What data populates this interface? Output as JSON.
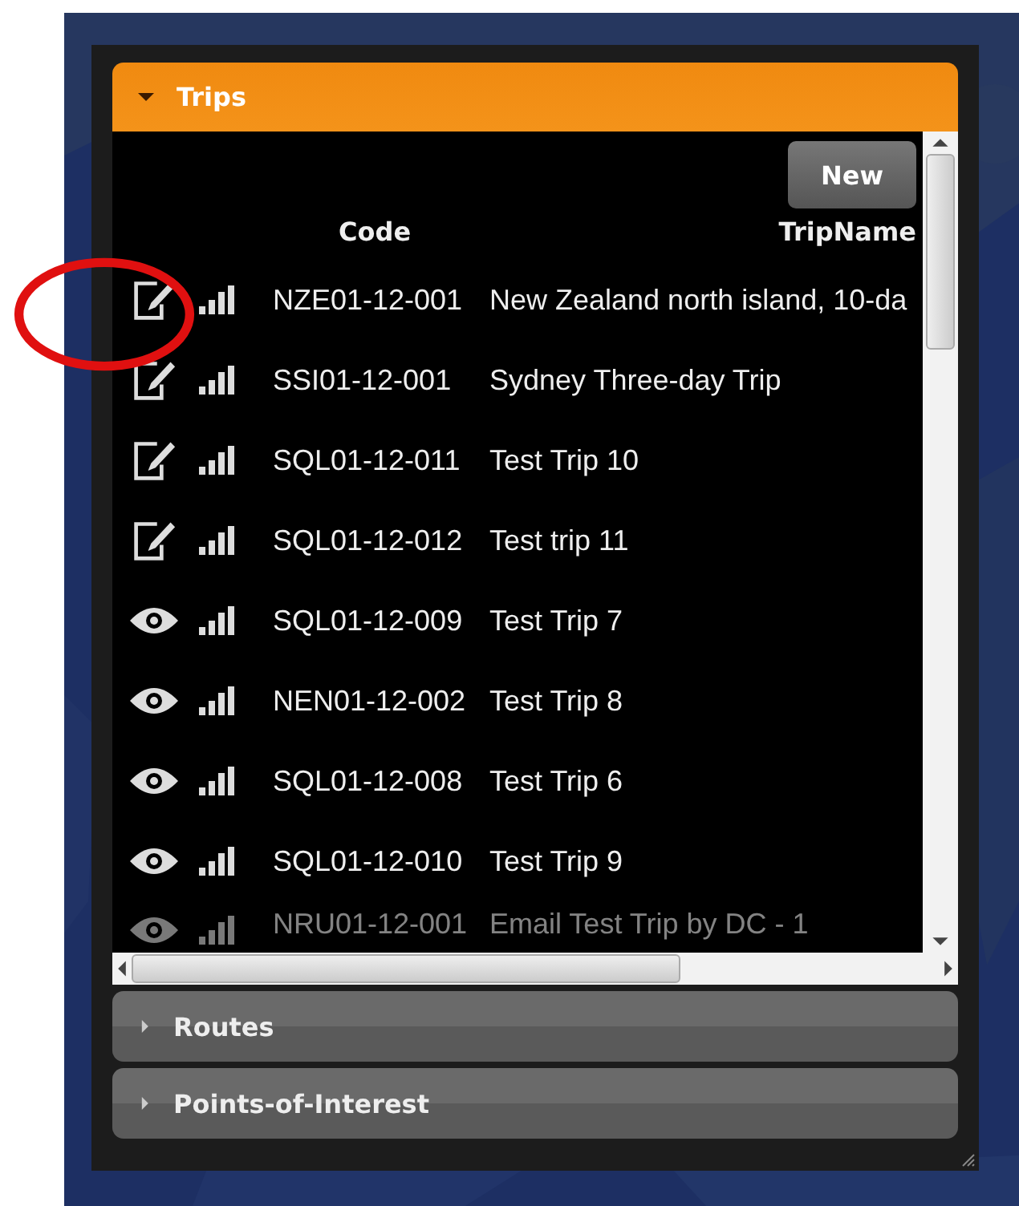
{
  "panels": [
    {
      "title": "Trips",
      "expanded": true
    },
    {
      "title": "Routes",
      "expanded": false
    },
    {
      "title": "Points-of-Interest",
      "expanded": false
    }
  ],
  "new_button": "New",
  "columns": [
    "Code",
    "TripName"
  ],
  "rows": [
    {
      "kind": "edit",
      "code": "NZE01-12-001",
      "name": "New Zealand north island, 10-da"
    },
    {
      "kind": "edit",
      "code": "SSI01-12-001",
      "name": "Sydney Three-day Trip"
    },
    {
      "kind": "edit",
      "code": "SQL01-12-011",
      "name": "Test Trip 10"
    },
    {
      "kind": "edit",
      "code": "SQL01-12-012",
      "name": "Test trip 11"
    },
    {
      "kind": "view",
      "code": "SQL01-12-009",
      "name": "Test Trip 7"
    },
    {
      "kind": "view",
      "code": "NEN01-12-002",
      "name": "Test Trip 8"
    },
    {
      "kind": "view",
      "code": "SQL01-12-008",
      "name": "Test Trip 6"
    },
    {
      "kind": "view",
      "code": "SQL01-12-010",
      "name": "Test Trip 9"
    },
    {
      "kind": "view",
      "code": "NRU01-12-001",
      "name": "Email Test Trip by DC - 1"
    }
  ]
}
